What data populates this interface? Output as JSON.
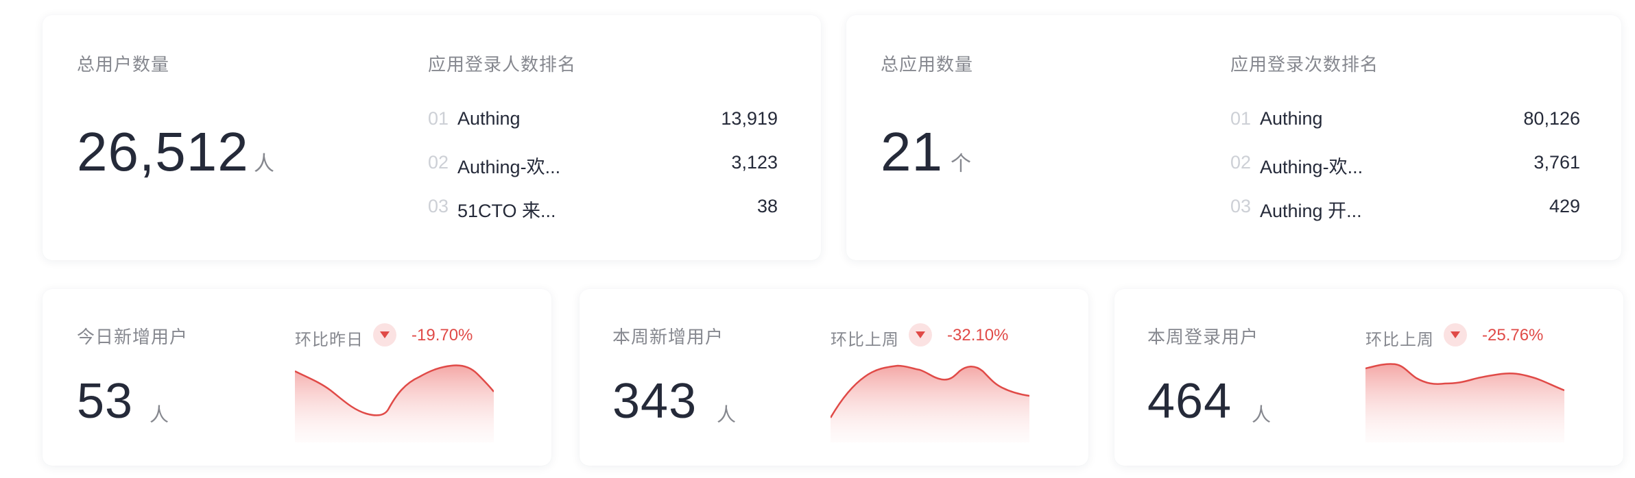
{
  "colors": {
    "accent_red": "#e04a47",
    "badge_bg": "#fbe2e2",
    "text_main": "#252a39",
    "text_muted": "#86888f",
    "rank_number": "#cdd0d6"
  },
  "users_card": {
    "title": "总用户数量",
    "value": "26,512",
    "unit": "人",
    "ranking_title": "应用登录人数排名",
    "ranking": [
      {
        "no": "01",
        "name": "Authing",
        "value": "13,919"
      },
      {
        "no": "02",
        "name": "Authing-欢...",
        "value": "3,123"
      },
      {
        "no": "03",
        "name": "51CTO 来...",
        "value": "38"
      }
    ]
  },
  "apps_card": {
    "title": "总应用数量",
    "value": "21",
    "unit": "个",
    "ranking_title": "应用登录次数排名",
    "ranking": [
      {
        "no": "01",
        "name": "Authing",
        "value": "80,126"
      },
      {
        "no": "02",
        "name": "Authing-欢...",
        "value": "3,761"
      },
      {
        "no": "03",
        "name": "Authing 开...",
        "value": "429"
      }
    ]
  },
  "stats": [
    {
      "title": "今日新增用户",
      "value": "53",
      "unit": "人",
      "compare_label": "环比昨日",
      "trend_icon": "arrow-down-icon",
      "change": "-19.70%"
    },
    {
      "title": "本周新增用户",
      "value": "343",
      "unit": "人",
      "compare_label": "环比上周",
      "trend_icon": "arrow-down-icon",
      "change": "-32.10%"
    },
    {
      "title": "本周登录用户",
      "value": "464",
      "unit": "人",
      "compare_label": "环比上周",
      "trend_icon": "arrow-down-icon",
      "change": "-25.76%"
    }
  ]
}
